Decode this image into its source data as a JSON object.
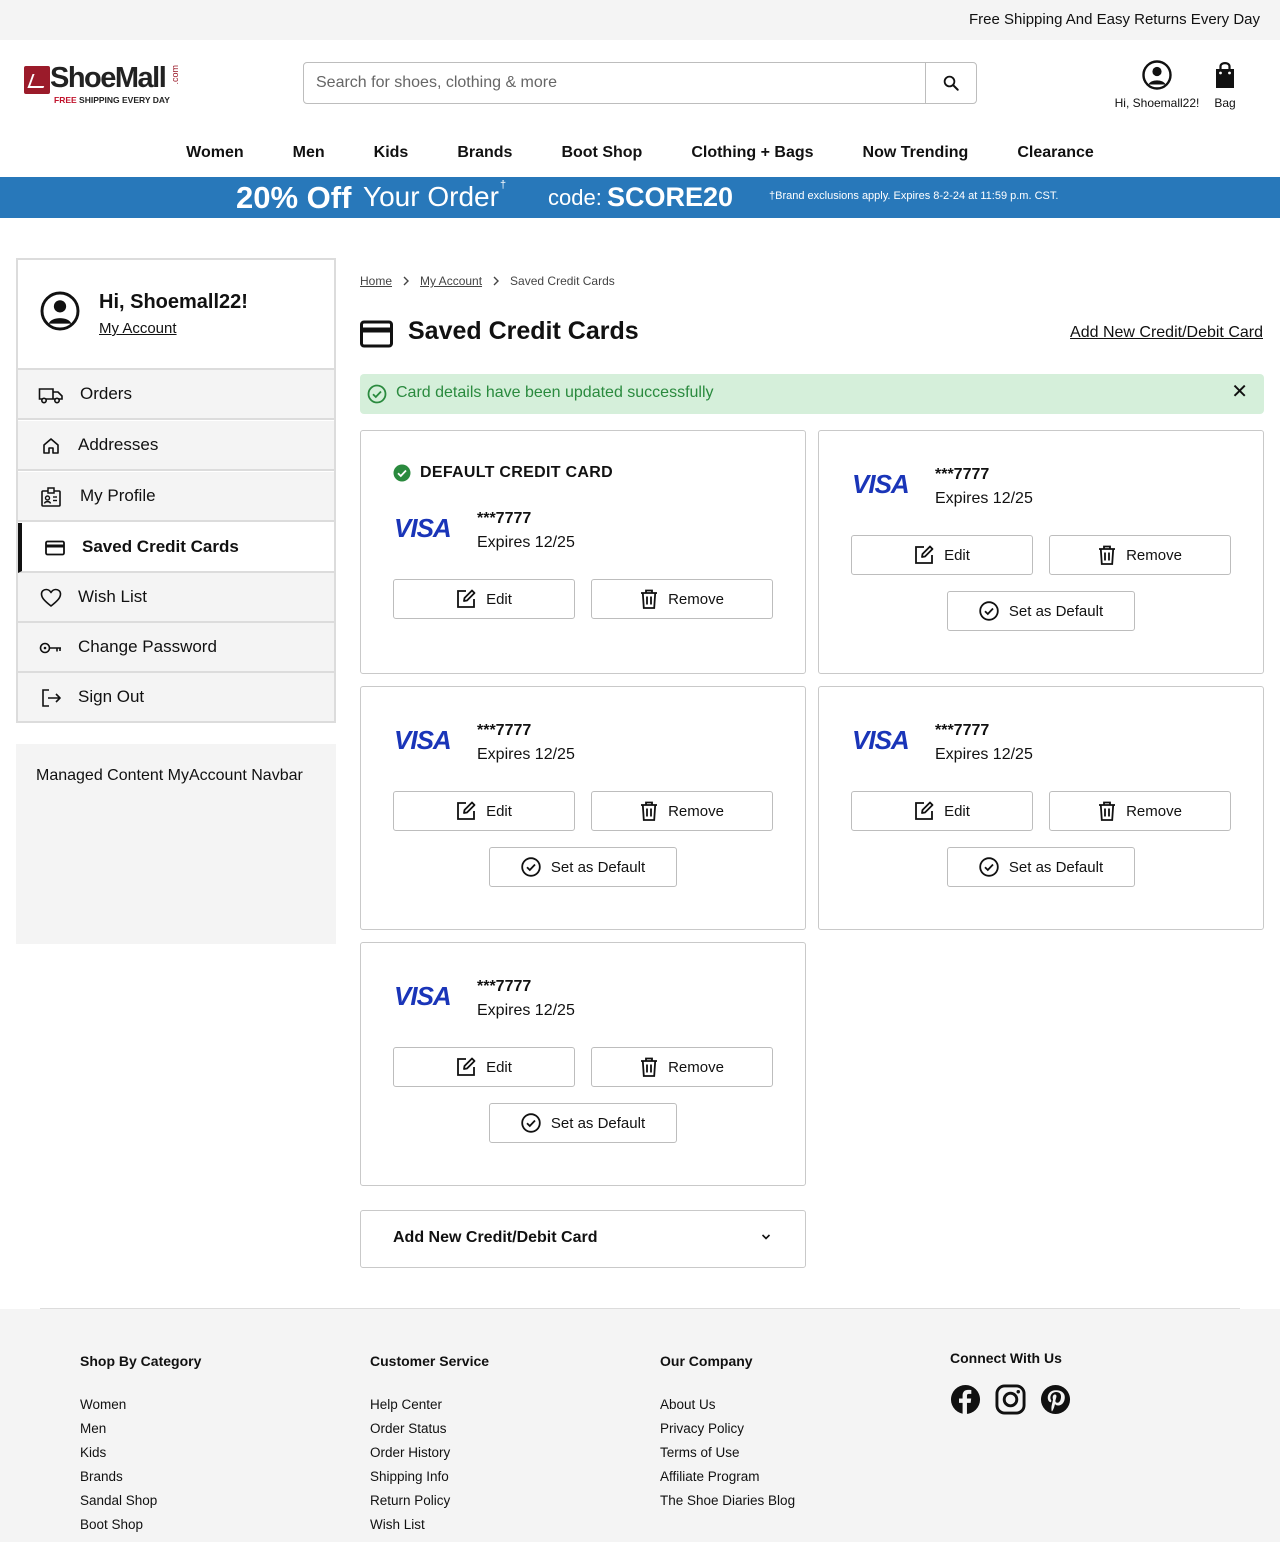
{
  "topbar": {
    "text": "Free Shipping And Easy Returns Every Day"
  },
  "logo": {
    "word": "ShoeMall",
    "com": ".com",
    "tag_free": "FREE",
    "tag_rest": " SHIPPING EVERY DAY"
  },
  "search": {
    "placeholder": "Search for shoes, clothing & more",
    "icon": "search-icon"
  },
  "header": {
    "account_label": "Hi, Shoemall22!",
    "bag_label": "Bag"
  },
  "nav": [
    "Women",
    "Men",
    "Kids",
    "Brands",
    "Boot Shop",
    "Clothing + Bags",
    "Now Trending",
    "Clearance"
  ],
  "promo": {
    "big": "20% Off",
    "your_order": "Your Order",
    "dagger": "†",
    "code_label": "code:",
    "code": "SCORE20",
    "fine_print": "†Brand exclusions apply. Expires 8-2-24 at 11:59 p.m. CST.",
    "background": "#2878ba"
  },
  "sidebar": {
    "greeting": "Hi, Shoemall22!",
    "my_account": "My Account",
    "items": [
      {
        "label": "Orders",
        "icon": "truck-icon"
      },
      {
        "label": "Addresses",
        "icon": "home-icon"
      },
      {
        "label": "My Profile",
        "icon": "profile-badge-icon"
      },
      {
        "label": "Saved Credit Cards",
        "icon": "credit-card-icon",
        "active": true
      },
      {
        "label": "Wish List",
        "icon": "heart-icon"
      },
      {
        "label": "Change Password",
        "icon": "key-icon"
      },
      {
        "label": "Sign Out",
        "icon": "sign-out-icon"
      }
    ],
    "managed_content": "Managed Content MyAccount Navbar"
  },
  "breadcrumb": [
    "Home",
    "My Account",
    "Saved Credit Cards"
  ],
  "page": {
    "title": "Saved Credit Cards",
    "add_link": "Add New Credit/Debit Card"
  },
  "alert": {
    "text": "Card details have been updated successfully",
    "close": "✕",
    "color": "#2a8a3e"
  },
  "cards": [
    {
      "default_label": "DEFAULT CREDIT CARD",
      "brand": "VISA",
      "number": "***7777",
      "expires": "Expires 12/25"
    },
    {
      "brand": "VISA",
      "number": "***7777",
      "expires": "Expires 12/25"
    },
    {
      "brand": "VISA",
      "number": "***7777",
      "expires": "Expires 12/25"
    },
    {
      "brand": "VISA",
      "number": "***7777",
      "expires": "Expires 12/25"
    },
    {
      "brand": "VISA",
      "number": "***7777",
      "expires": "Expires 12/25"
    }
  ],
  "card_buttons": {
    "edit": "Edit",
    "remove": "Remove",
    "set_default": "Set as Default"
  },
  "add_panel": {
    "label": "Add New Credit/Debit Card"
  },
  "footer": {
    "shop": {
      "title": "Shop By Category",
      "links": [
        "Women",
        "Men",
        "Kids",
        "Brands",
        "Sandal Shop",
        "Boot Shop"
      ]
    },
    "service": {
      "title": "Customer Service",
      "links": [
        "Help Center",
        "Order Status",
        "Order History",
        "Shipping Info",
        "Return Policy",
        "Wish List"
      ]
    },
    "company": {
      "title": "Our Company",
      "links": [
        "About Us",
        "Privacy Policy",
        "Terms of Use",
        "Affiliate Program",
        "The Shoe Diaries Blog"
      ]
    },
    "connect": {
      "title": "Connect With Us",
      "icons": [
        "facebook-icon",
        "instagram-icon",
        "pinterest-icon"
      ]
    }
  }
}
